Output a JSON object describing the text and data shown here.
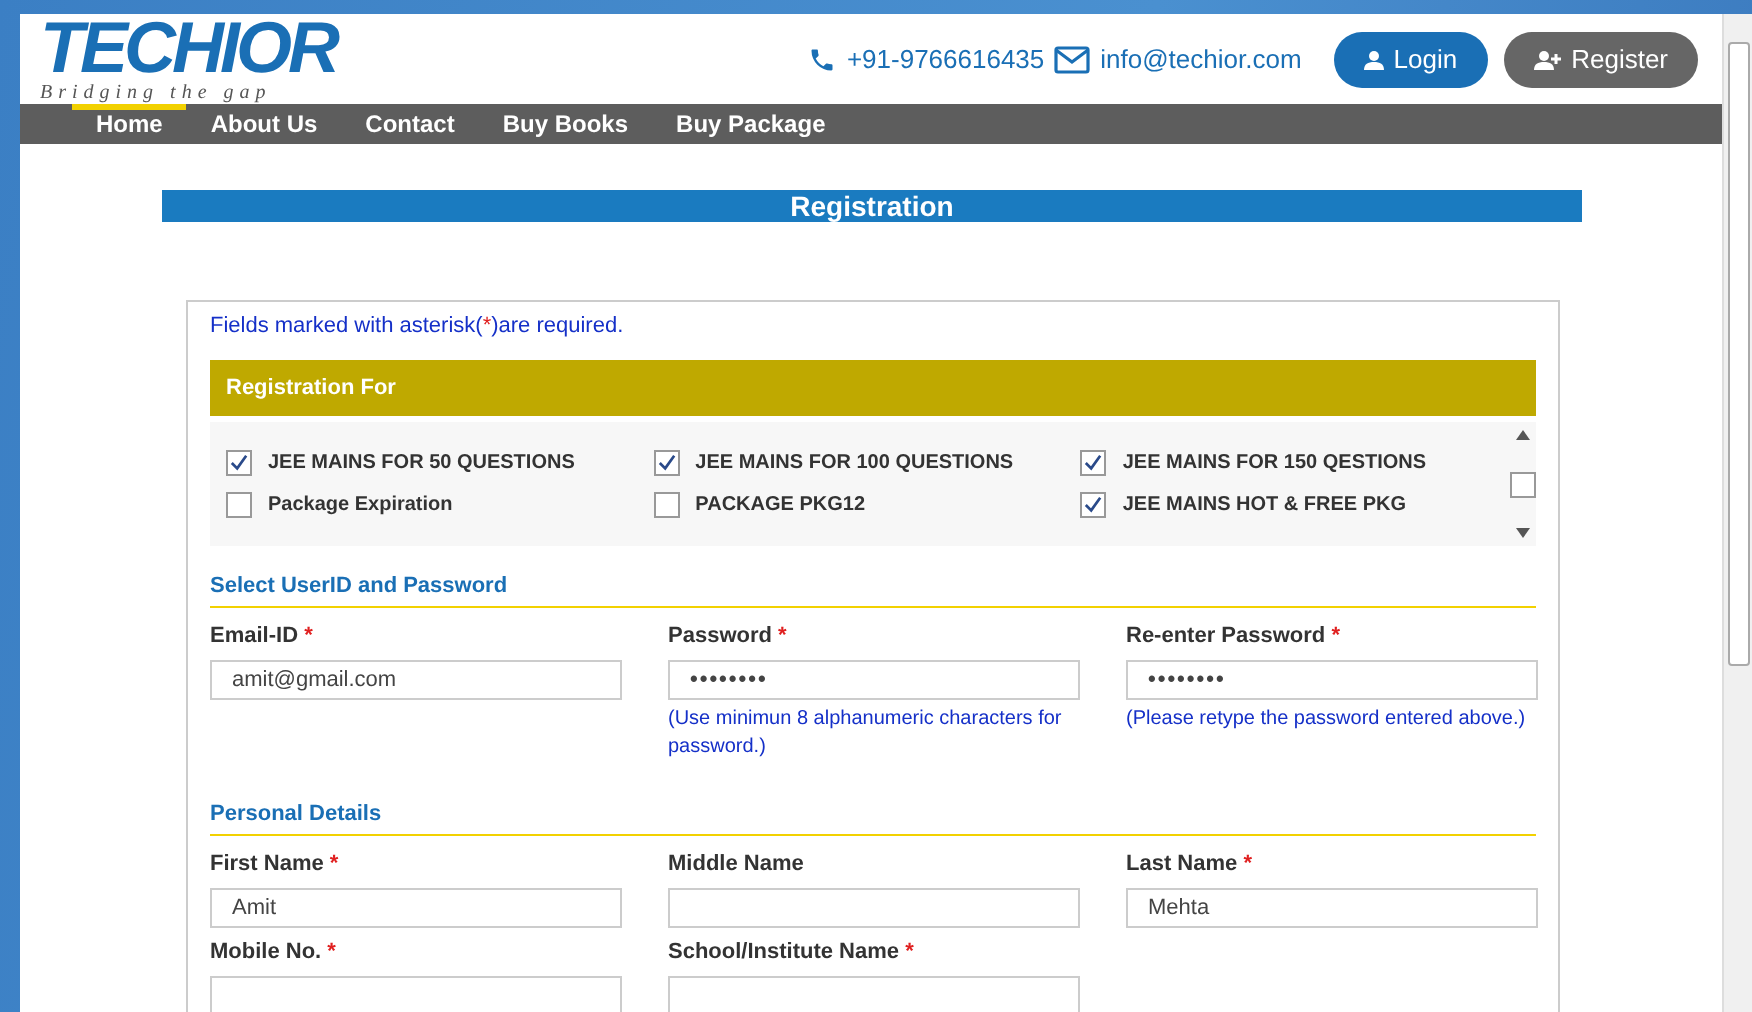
{
  "header": {
    "logo": {
      "name": "TECHIOR",
      "tagline": "Bridging the gap"
    },
    "phone": "+91-9766616435",
    "email": "info@techior.com",
    "buttons": [
      {
        "label": "Login",
        "kind": "primary"
      },
      {
        "label": "Register",
        "kind": "secondary"
      }
    ]
  },
  "nav": [
    {
      "label": "Home",
      "selected": true
    },
    {
      "label": "About Us",
      "selected": false
    },
    {
      "label": "Contact",
      "selected": false
    },
    {
      "label": "Buy Books",
      "selected": false
    },
    {
      "label": "Buy Package",
      "selected": false
    }
  ],
  "page_title": "Registration",
  "note": {
    "before": "Fields marked with asterisk(",
    "mark": "*",
    "after": ")are required."
  },
  "registration_for": {
    "title": "Registration For",
    "packages": [
      {
        "label": "JEE MAINS FOR 50 QUESTIONS",
        "checked": true
      },
      {
        "label": "JEE MAINS FOR 100 QUESTIONS",
        "checked": true
      },
      {
        "label": "JEE MAINS FOR 150 QESTIONS",
        "checked": true
      },
      {
        "label": "Package Expiration",
        "checked": false
      },
      {
        "label": "PACKAGE PKG12",
        "checked": false
      },
      {
        "label": "JEE MAINS HOT & FREE PKG",
        "checked": true
      }
    ]
  },
  "sections": [
    {
      "title": "Select UserID and Password",
      "fields": [
        {
          "label": "Email-ID",
          "required": true,
          "kind": "text",
          "value": "amit@gmail.com"
        },
        {
          "label": "Password",
          "required": true,
          "kind": "password",
          "value": "••••••••",
          "hint": "(Use minimun 8 alphanumeric characters for password.)"
        },
        {
          "label": "Re-enter Password",
          "required": true,
          "kind": "password",
          "value": "••••••••",
          "hint": "(Please retype the password entered above.)"
        }
      ]
    },
    {
      "title": "Personal Details",
      "fields": [
        {
          "label": "First Name",
          "required": true,
          "kind": "text",
          "value": "Amit"
        },
        {
          "label": "Middle Name",
          "required": false,
          "kind": "text"
        },
        {
          "label": "Last Name",
          "required": true,
          "kind": "text",
          "value": "Mehta"
        },
        {
          "label": "Mobile No.",
          "required": true,
          "kind": "text"
        },
        {
          "label": "School/Institute Name",
          "required": true,
          "kind": "text"
        }
      ]
    }
  ]
}
